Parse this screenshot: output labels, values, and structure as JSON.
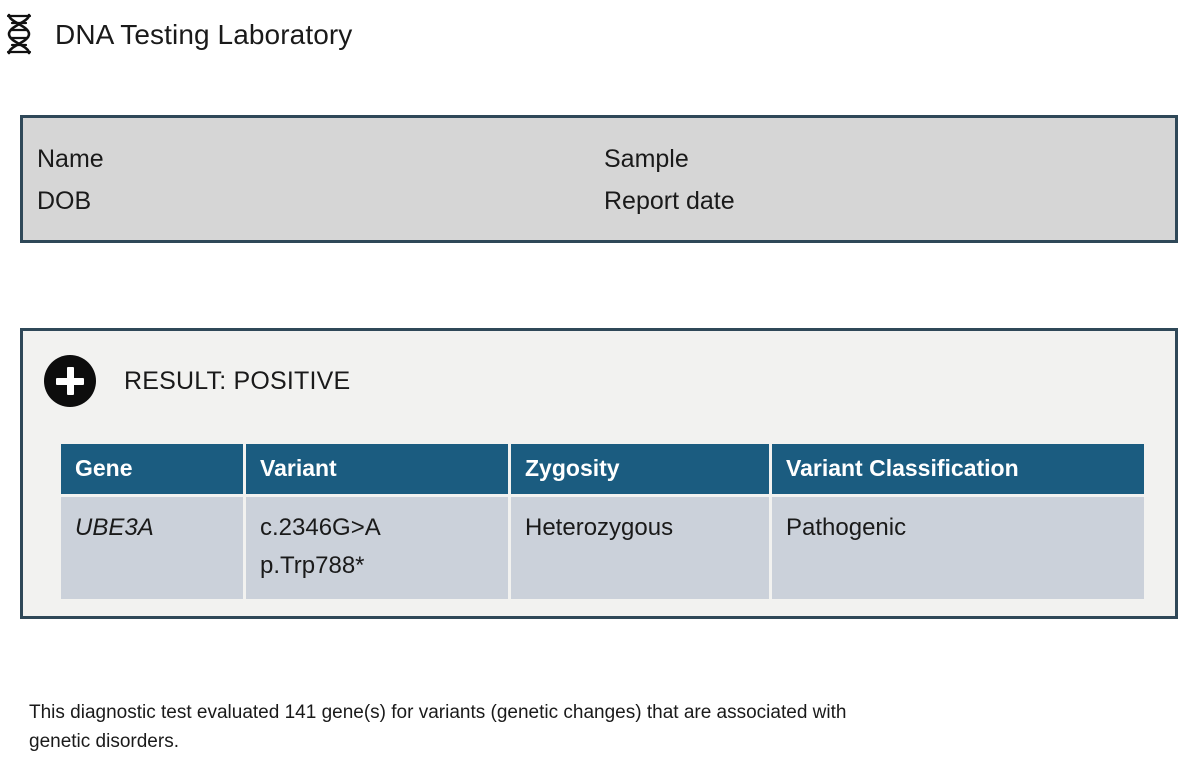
{
  "header": {
    "icon": "dna-helix-icon",
    "title": "DNA Testing Laboratory"
  },
  "patient_panel": {
    "fields": [
      {
        "label": "Name",
        "value": ""
      },
      {
        "label": "Sample",
        "value": ""
      },
      {
        "label": "DOB",
        "value": ""
      },
      {
        "label": "Report date",
        "value": ""
      }
    ]
  },
  "result_card": {
    "icon": "plus-circle-icon",
    "result_label": "RESULT: POSITIVE",
    "table": {
      "columns": [
        "Gene",
        "Variant",
        "Zygosity",
        "Variant Classification"
      ],
      "rows": [
        {
          "gene": "UBE3A",
          "variant_c": "c.2346G>A",
          "variant_p": "p.Trp788*",
          "zygosity": "Heterozygous",
          "classification": "Pathogenic"
        }
      ]
    }
  },
  "footer": {
    "note": "This diagnostic test evaluated 141 gene(s) for variants (genetic changes) that are associated with genetic disorders.",
    "gene_count": "141"
  },
  "colors": {
    "header_teal": "#1b5c80",
    "row_fill": "#cbd1da",
    "panel_gray": "#d6d6d6",
    "card_bg": "#f2f2f0",
    "border_navy": "#2f4858",
    "badge_black": "#0d0d0d"
  }
}
